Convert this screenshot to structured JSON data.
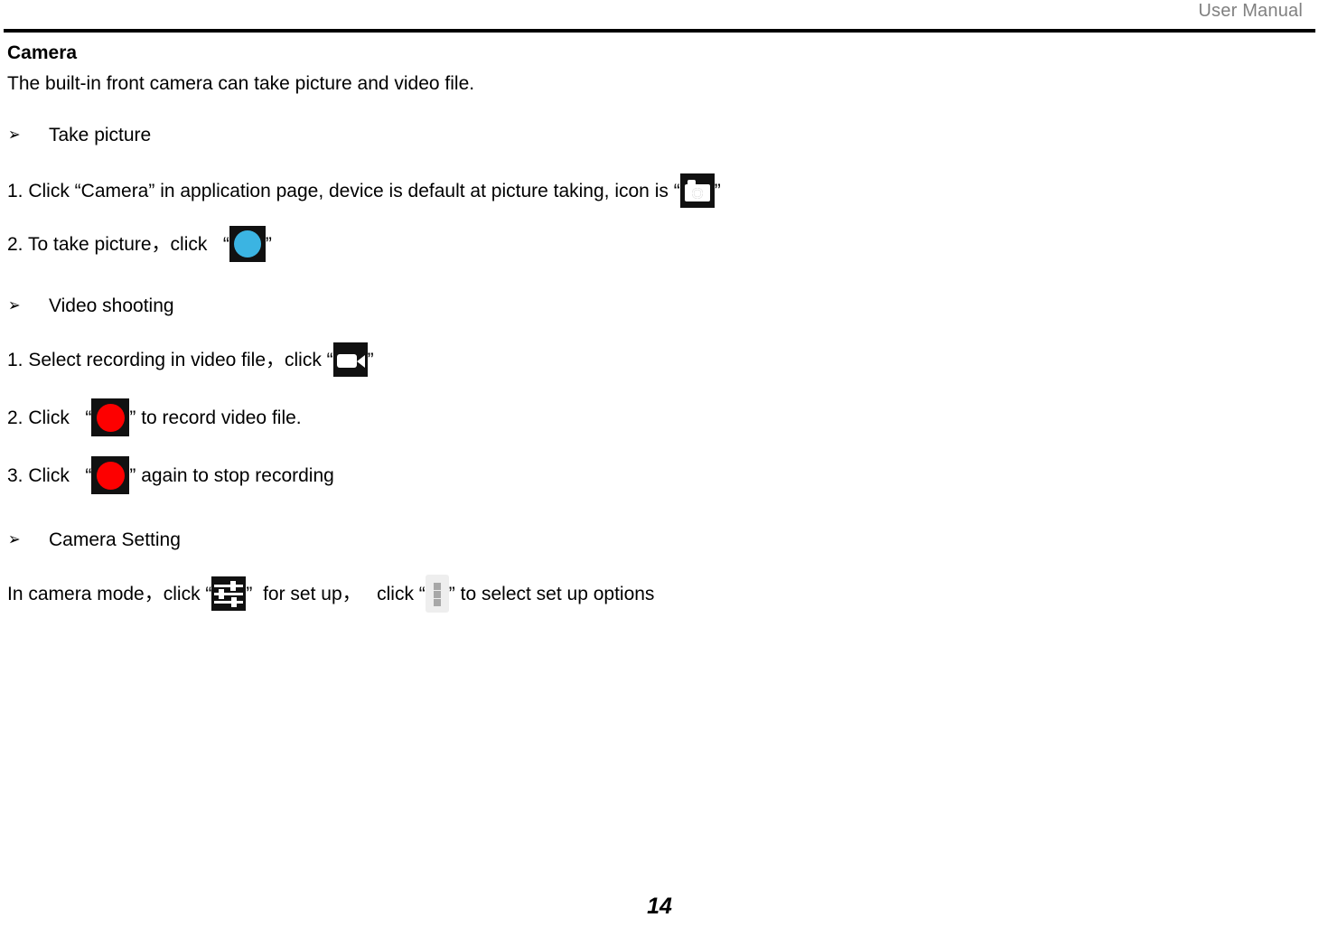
{
  "header": {
    "title": "User Manual"
  },
  "document": {
    "section_title": "Camera",
    "intro": "The built-in front camera can take picture and video file.",
    "bullet_glyph": "➢",
    "quote_open": "“",
    "quote_close": "”",
    "groups": [
      {
        "bullet": "Take picture",
        "steps": [
          {
            "prefix": "1. Click “Camera” in application page, device is default at picture taking, icon is ",
            "icon": "photo-camera-icon",
            "suffix": ""
          },
          {
            "prefix": "2. To take picture，click   ",
            "icon": "shutter-button-icon",
            "suffix": ""
          }
        ]
      },
      {
        "bullet": "Video shooting",
        "steps": [
          {
            "prefix": "1. Select recording in video file，click ",
            "icon": "camcorder-icon",
            "suffix": ""
          },
          {
            "prefix": "2. Click   ",
            "icon": "record-button-icon",
            "suffix": " to record video file."
          },
          {
            "prefix": "3. Click   ",
            "icon": "record-button-icon",
            "suffix": " again to stop recording"
          }
        ]
      },
      {
        "bullet": "Camera Setting",
        "steps": [
          {
            "prefix": "In camera mode，click ",
            "icon": "settings-sliders-icon",
            "middle": "  for set up，   click ",
            "icon2": "overflow-menu-icon",
            "suffix": " to select set up options"
          }
        ]
      }
    ]
  },
  "footer": {
    "page_number": "14"
  },
  "colors": {
    "header_text": "#808080",
    "shutter_blue": "#3bb4e2",
    "record_red": "#fd0000",
    "icon_background": "#111111",
    "kebab_background": "#eeeeee"
  }
}
